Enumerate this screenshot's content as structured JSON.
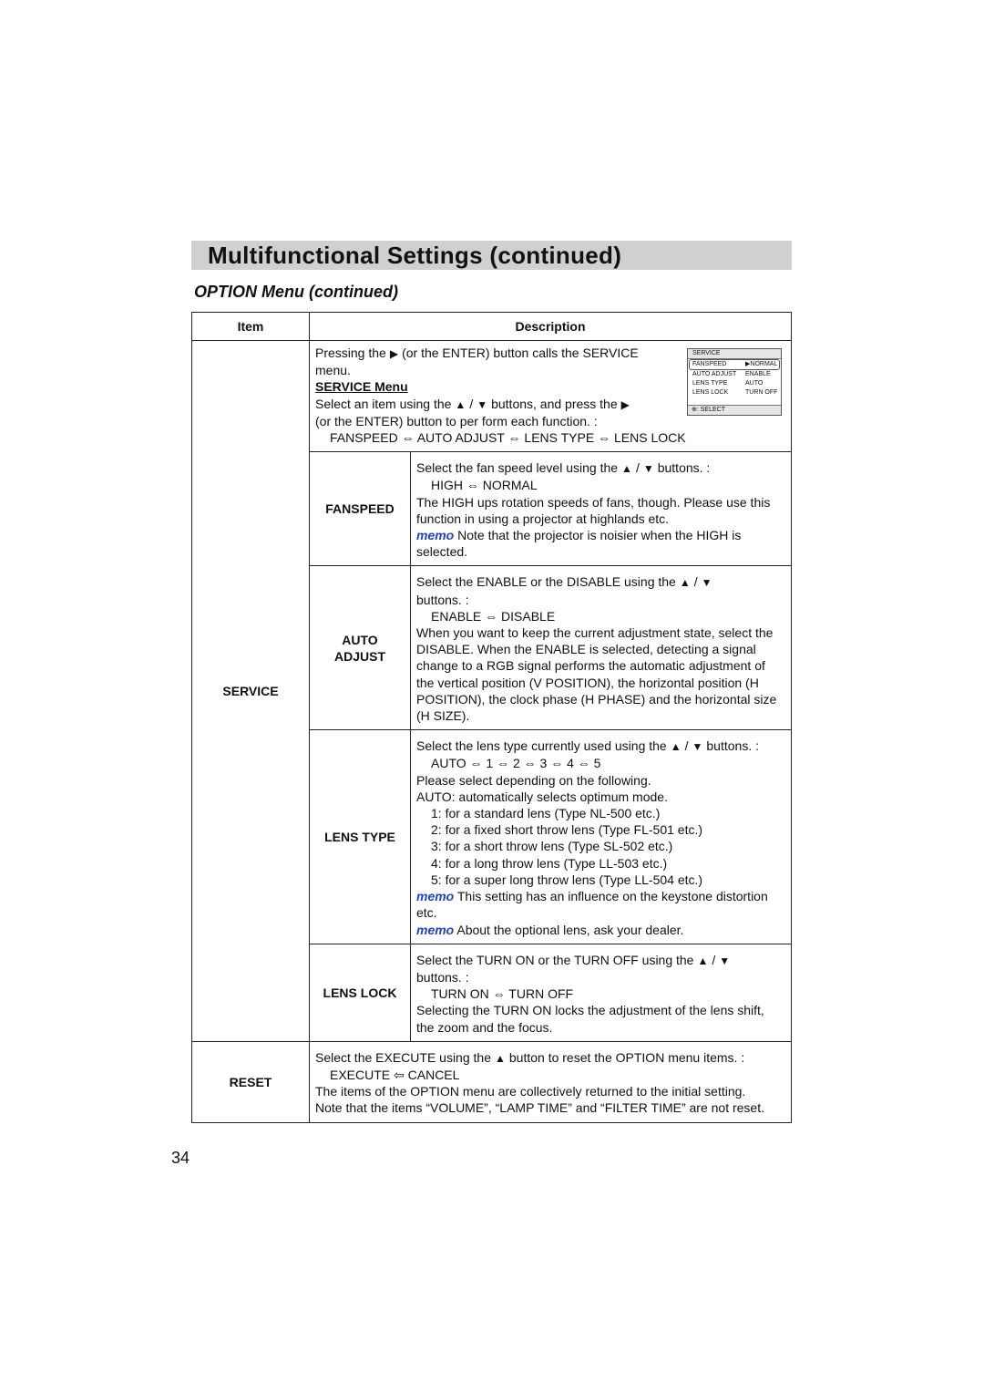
{
  "header": {
    "title": "Multifunctional Settings (continued)",
    "subtitle": "OPTION Menu (continued)"
  },
  "table": {
    "col_item": "Item",
    "col_description": "Description",
    "service": {
      "label": "SERVICE",
      "intro": {
        "line1_pre": "Pressing the",
        "line1_post": "(or the ENTER) button calls the SERVICE",
        "line2": "menu.",
        "heading": "SERVICE Menu",
        "line3_pre": "Select an item using the",
        "line3_sep": "/",
        "line3_mid": "buttons, and press the",
        "line4": "(or the ENTER) button to per form each function. :",
        "sequence": "FANSPEED ⇔ AUTO ADJUST ⇔ LENS TYPE ⇔ LENS LOCK"
      },
      "menu_preview": {
        "title": "SERVICE",
        "rows": [
          {
            "item": "FANSPEED",
            "value": "▶NORMAL"
          },
          {
            "item": "AUTO ADJUST",
            "value": "ENABLE"
          },
          {
            "item": "LENS TYPE",
            "value": "AUTO"
          },
          {
            "item": "LENS LOCK",
            "value": "TURN OFF"
          }
        ],
        "footer": ": SELECT"
      },
      "subitems": {
        "fanspeed": {
          "label": "FANSPEED",
          "line1": "Select the fan speed level using the",
          "line1_end": "buttons. :",
          "options": "HIGH ⇔ NORMAL",
          "text": "The HIGH ups rotation speeds of fans, though. Please use this function in using a projector at highlands etc.",
          "memo_label": "memo",
          "memo": " Note that the projector is noisier when the HIGH is selected."
        },
        "auto_adjust": {
          "label_line1": "AUTO",
          "label_line2": "ADJUST",
          "line1": "Select the ENABLE or the DISABLE using the",
          "line2": "buttons. :",
          "options": "ENABLE ⇔ DISABLE",
          "text": "When you want to keep the current adjustment state, select the DISABLE. When the ENABLE is selected, detecting a signal change to a RGB signal performs the automatic adjustment of the vertical position (V POSITION), the horizontal position (H POSITION), the clock phase (H PHASE) and the horizontal size (H SIZE)."
        },
        "lens_type": {
          "label": "LENS TYPE",
          "line1": "Select the lens type currently used using the",
          "line1_end": "buttons. :",
          "options": "AUTO ⇔ 1 ⇔ 2 ⇔ 3 ⇔ 4 ⇔ 5",
          "line2": "Please select depending on the following.",
          "line3": "AUTO: automatically selects optimum mode.",
          "list": [
            "1: for a standard lens (Type NL-500 etc.)",
            "2: for a fixed short throw lens (Type FL-501 etc.)",
            "3: for a short throw lens (Type SL-502 etc.)",
            "4: for a long throw lens (Type LL-503 etc.)",
            "5: for a super long throw lens (Type LL-504 etc.)"
          ],
          "memo_label": "memo",
          "memo1": " This setting has an influence on the keystone distortion etc.",
          "memo2": " About the optional lens, ask your dealer."
        },
        "lens_lock": {
          "label": "LENS LOCK",
          "line1": "Select the TURN ON or the TURN OFF using the",
          "line2": "buttons. :",
          "options": "TURN ON ⇔ TURN OFF",
          "text": "Selecting the TURN ON locks the adjustment of the lens shift, the zoom and the focus."
        }
      }
    },
    "reset": {
      "label": "RESET",
      "line1_pre": "Select the EXECUTE using the",
      "line1_post": "button to reset the OPTION menu items. :",
      "options": "EXECUTE ⇦ CANCEL",
      "line2": "The items of the OPTION menu are collectively returned to the initial setting.",
      "line3": "Note that the items “VOLUME”, “LAMP TIME” and “FILTER TIME” are not reset."
    }
  },
  "icons": {
    "right": "▶",
    "up": "▲",
    "down": "▼"
  },
  "footer": {
    "page_number": "34"
  }
}
